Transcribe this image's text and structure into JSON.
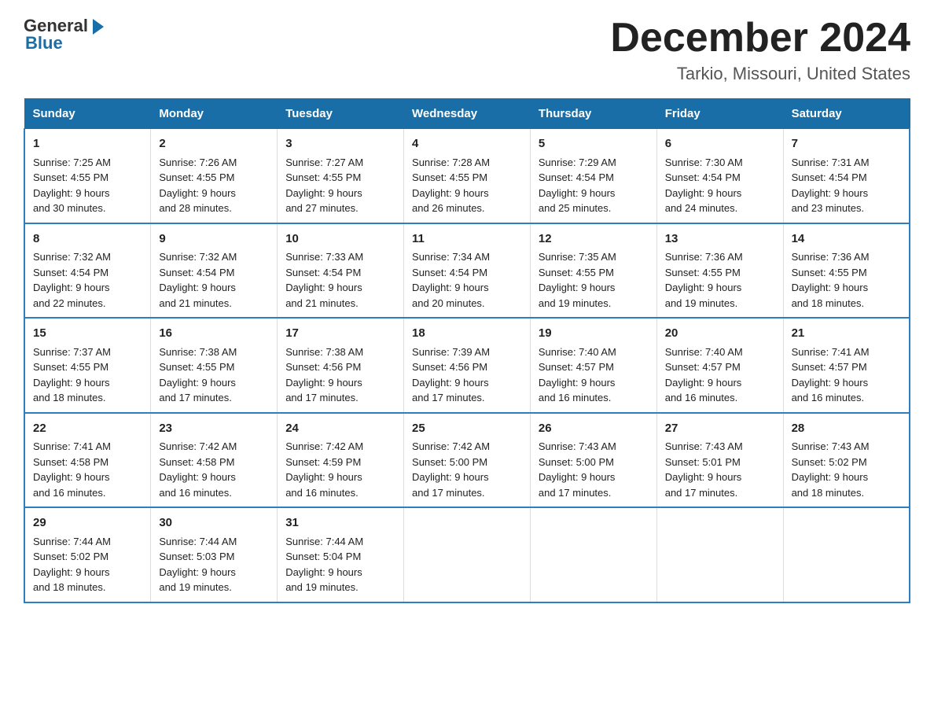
{
  "header": {
    "logo_text": "General",
    "logo_blue": "Blue",
    "main_title": "December 2024",
    "subtitle": "Tarkio, Missouri, United States"
  },
  "days_of_week": [
    "Sunday",
    "Monday",
    "Tuesday",
    "Wednesday",
    "Thursday",
    "Friday",
    "Saturday"
  ],
  "weeks": [
    [
      {
        "day": "1",
        "sunrise": "7:25 AM",
        "sunset": "4:55 PM",
        "daylight": "9 hours and 30 minutes."
      },
      {
        "day": "2",
        "sunrise": "7:26 AM",
        "sunset": "4:55 PM",
        "daylight": "9 hours and 28 minutes."
      },
      {
        "day": "3",
        "sunrise": "7:27 AM",
        "sunset": "4:55 PM",
        "daylight": "9 hours and 27 minutes."
      },
      {
        "day": "4",
        "sunrise": "7:28 AM",
        "sunset": "4:55 PM",
        "daylight": "9 hours and 26 minutes."
      },
      {
        "day": "5",
        "sunrise": "7:29 AM",
        "sunset": "4:54 PM",
        "daylight": "9 hours and 25 minutes."
      },
      {
        "day": "6",
        "sunrise": "7:30 AM",
        "sunset": "4:54 PM",
        "daylight": "9 hours and 24 minutes."
      },
      {
        "day": "7",
        "sunrise": "7:31 AM",
        "sunset": "4:54 PM",
        "daylight": "9 hours and 23 minutes."
      }
    ],
    [
      {
        "day": "8",
        "sunrise": "7:32 AM",
        "sunset": "4:54 PM",
        "daylight": "9 hours and 22 minutes."
      },
      {
        "day": "9",
        "sunrise": "7:32 AM",
        "sunset": "4:54 PM",
        "daylight": "9 hours and 21 minutes."
      },
      {
        "day": "10",
        "sunrise": "7:33 AM",
        "sunset": "4:54 PM",
        "daylight": "9 hours and 21 minutes."
      },
      {
        "day": "11",
        "sunrise": "7:34 AM",
        "sunset": "4:54 PM",
        "daylight": "9 hours and 20 minutes."
      },
      {
        "day": "12",
        "sunrise": "7:35 AM",
        "sunset": "4:55 PM",
        "daylight": "9 hours and 19 minutes."
      },
      {
        "day": "13",
        "sunrise": "7:36 AM",
        "sunset": "4:55 PM",
        "daylight": "9 hours and 19 minutes."
      },
      {
        "day": "14",
        "sunrise": "7:36 AM",
        "sunset": "4:55 PM",
        "daylight": "9 hours and 18 minutes."
      }
    ],
    [
      {
        "day": "15",
        "sunrise": "7:37 AM",
        "sunset": "4:55 PM",
        "daylight": "9 hours and 18 minutes."
      },
      {
        "day": "16",
        "sunrise": "7:38 AM",
        "sunset": "4:55 PM",
        "daylight": "9 hours and 17 minutes."
      },
      {
        "day": "17",
        "sunrise": "7:38 AM",
        "sunset": "4:56 PM",
        "daylight": "9 hours and 17 minutes."
      },
      {
        "day": "18",
        "sunrise": "7:39 AM",
        "sunset": "4:56 PM",
        "daylight": "9 hours and 17 minutes."
      },
      {
        "day": "19",
        "sunrise": "7:40 AM",
        "sunset": "4:57 PM",
        "daylight": "9 hours and 16 minutes."
      },
      {
        "day": "20",
        "sunrise": "7:40 AM",
        "sunset": "4:57 PM",
        "daylight": "9 hours and 16 minutes."
      },
      {
        "day": "21",
        "sunrise": "7:41 AM",
        "sunset": "4:57 PM",
        "daylight": "9 hours and 16 minutes."
      }
    ],
    [
      {
        "day": "22",
        "sunrise": "7:41 AM",
        "sunset": "4:58 PM",
        "daylight": "9 hours and 16 minutes."
      },
      {
        "day": "23",
        "sunrise": "7:42 AM",
        "sunset": "4:58 PM",
        "daylight": "9 hours and 16 minutes."
      },
      {
        "day": "24",
        "sunrise": "7:42 AM",
        "sunset": "4:59 PM",
        "daylight": "9 hours and 16 minutes."
      },
      {
        "day": "25",
        "sunrise": "7:42 AM",
        "sunset": "5:00 PM",
        "daylight": "9 hours and 17 minutes."
      },
      {
        "day": "26",
        "sunrise": "7:43 AM",
        "sunset": "5:00 PM",
        "daylight": "9 hours and 17 minutes."
      },
      {
        "day": "27",
        "sunrise": "7:43 AM",
        "sunset": "5:01 PM",
        "daylight": "9 hours and 17 minutes."
      },
      {
        "day": "28",
        "sunrise": "7:43 AM",
        "sunset": "5:02 PM",
        "daylight": "9 hours and 18 minutes."
      }
    ],
    [
      {
        "day": "29",
        "sunrise": "7:44 AM",
        "sunset": "5:02 PM",
        "daylight": "9 hours and 18 minutes."
      },
      {
        "day": "30",
        "sunrise": "7:44 AM",
        "sunset": "5:03 PM",
        "daylight": "9 hours and 19 minutes."
      },
      {
        "day": "31",
        "sunrise": "7:44 AM",
        "sunset": "5:04 PM",
        "daylight": "9 hours and 19 minutes."
      },
      null,
      null,
      null,
      null
    ]
  ],
  "labels": {
    "sunrise": "Sunrise:",
    "sunset": "Sunset:",
    "daylight": "Daylight:"
  }
}
